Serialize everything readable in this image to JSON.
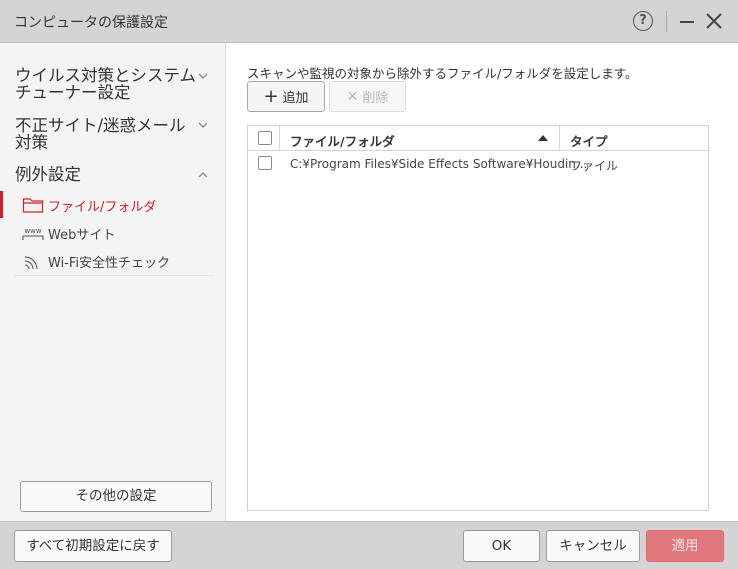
{
  "window": {
    "title": "コンピュータの保護設定",
    "help_label": "?"
  },
  "sidebar": {
    "categories": [
      {
        "label_line1": "ウイルス対策とシステム",
        "label_line2": "チューナー設定",
        "expanded": false
      },
      {
        "label_line1": "不正サイト/迷惑メール",
        "label_line2": "対策",
        "expanded": false
      },
      {
        "label_line1": "例外設定",
        "expanded": true
      }
    ],
    "sub_items": [
      {
        "label": "ファイル/フォルダ",
        "icon": "folder-icon",
        "active": true
      },
      {
        "label": "Webサイト",
        "icon": "www-icon",
        "active": false
      },
      {
        "label": "Wi-Fi安全性チェック",
        "icon": "wifi-icon",
        "active": false
      }
    ],
    "other_settings_label": "その他の設定",
    "www_icon_text": "www"
  },
  "main": {
    "description": "スキャンや監視の対象から除外するファイル/フォルダを設定します。",
    "add_label": "追加",
    "delete_label": "削除",
    "table": {
      "columns": [
        {
          "label": "ファイル/フォルダ",
          "sort": "ascending"
        },
        {
          "label": "タイプ"
        }
      ],
      "rows": [
        {
          "path": "C:¥Program Files¥Side Effects Software¥Houdin...",
          "type": "ファイル",
          "checked": false
        }
      ]
    }
  },
  "footer": {
    "reset_label": "すべて初期設定に戻す",
    "ok_label": "OK",
    "cancel_label": "キャンセル",
    "apply_label": "適用"
  },
  "colors": {
    "accent": "#d0202a",
    "apply_disabled": "#e0787e"
  }
}
